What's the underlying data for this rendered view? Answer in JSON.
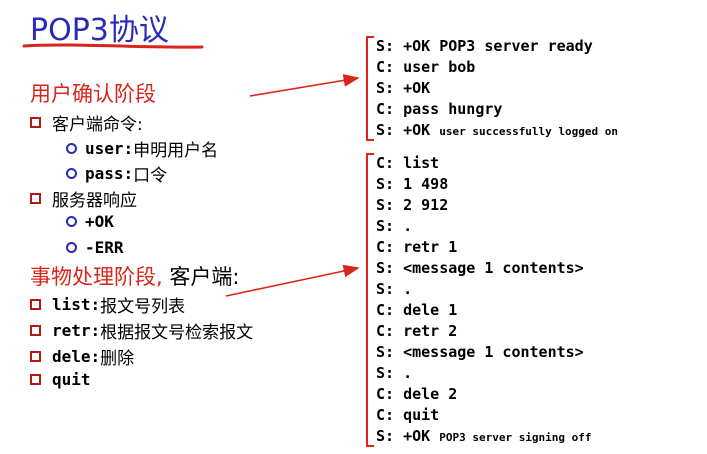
{
  "title": "POP3协议",
  "left": {
    "auth_heading": "用户确认阶段",
    "client_commands_label": "客户端命令:",
    "user_cmd": "user:",
    "user_desc": "申明用户名",
    "pass_cmd": "pass:",
    "pass_desc": "口令",
    "server_response_label": "服务器响应",
    "ok_label": "+OK",
    "err_label": "-ERR",
    "transaction_heading": "事物处理阶段,",
    "transaction_heading_suffix": " 客户端:",
    "list_cmd": "list:",
    "list_desc": "报文号列表",
    "retr_cmd": "retr:",
    "retr_desc": "根据报文号检索报文",
    "dele_cmd": "dele:",
    "dele_desc": "删除",
    "quit_cmd": "quit"
  },
  "auth_dialog": [
    {
      "text": "S: +OK POP3 server ready",
      "small": ""
    },
    {
      "text": "C: user bob",
      "small": ""
    },
    {
      "text": "S: +OK",
      "small": ""
    },
    {
      "text": "C: pass hungry",
      "small": ""
    },
    {
      "text": "S: +OK ",
      "small": "user successfully logged on"
    }
  ],
  "transaction_dialog": [
    {
      "text": "C: list",
      "small": ""
    },
    {
      "text": "S: 1 498",
      "small": ""
    },
    {
      "text": "S: 2 912",
      "small": ""
    },
    {
      "text": "S: .",
      "small": ""
    },
    {
      "text": "C: retr 1",
      "small": ""
    },
    {
      "text": "S: <message 1 contents>",
      "small": ""
    },
    {
      "text": "S: .",
      "small": ""
    },
    {
      "text": "C: dele 1",
      "small": ""
    },
    {
      "text": "C: retr 2",
      "small": ""
    },
    {
      "text": "S: <message 1 contents>",
      "small": ""
    },
    {
      "text": "S: .",
      "small": ""
    },
    {
      "text": "C: dele 2",
      "small": ""
    },
    {
      "text": "C: quit",
      "small": ""
    },
    {
      "text": "S: +OK ",
      "small": "POP3 server signing off"
    }
  ],
  "colors": {
    "title": "#2a2ab6",
    "accent_red": "#d9261c",
    "bullet_square": "#b01c14",
    "bullet_circle": "#2a2ab6"
  }
}
